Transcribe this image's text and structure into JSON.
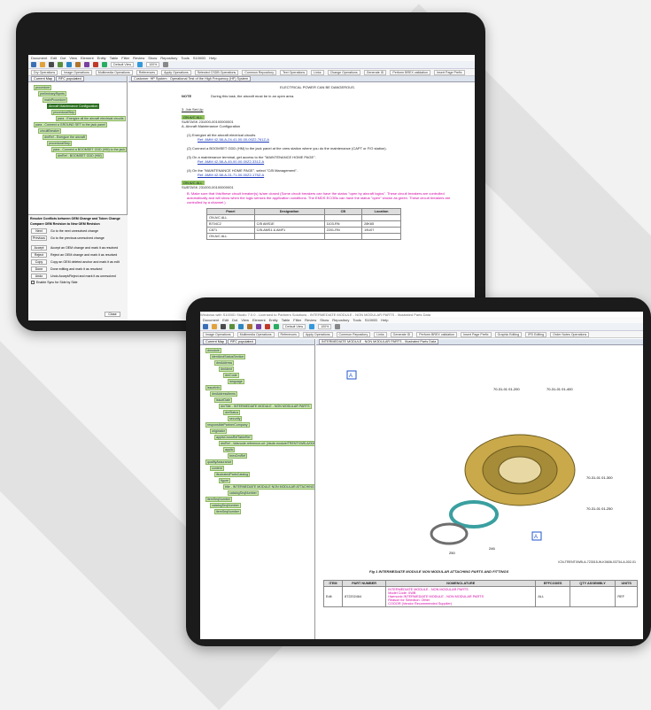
{
  "tablet_a": {
    "menu": [
      "Document",
      "Edit",
      "Dot",
      "View",
      "Element",
      "Entity",
      "Table",
      "Filter",
      "Review",
      "Show",
      "Repository",
      "Tools",
      "S1000D",
      "Help"
    ],
    "ops": [
      "Dry Operations",
      "Image Operations",
      "Multimedia Operations",
      "References",
      "Apply Operations",
      "Selected CSDB Operations",
      "Common Repository",
      "Text Operations",
      "Links",
      "Change Operations",
      "Generate ID",
      "Perform BREX validation",
      "Insert Page Prefix"
    ],
    "zoom": "100%",
    "style_select": "Default View",
    "tabs": [
      "Current Map",
      "RFC populated"
    ],
    "doc_tab": "Customer: HP System · Operational Test of the High Frequency (HF) System",
    "tree": [
      "procedure",
      "preliminaryRqmts",
      "mainProcedure",
      "Aircraft Maintenance Configuration",
      "proceduralStep",
      "para - Energize all the aircraft electrical circuits",
      "para - Connect a GROUND SET to the jack panel",
      "circuitBreaker",
      "dmRef - Energize the aircraft",
      "proceduralStep",
      "para - Connect a BOOMSET GDD (HM) to the jack",
      "dmRef - BOOMSET GDD (HM)"
    ],
    "caution": "ELECTRICAL POWER CAN BE DANGEROUS.",
    "note_label": "NOTE",
    "note_text": "During this task, the aircraft must be in an open area.",
    "section": "3.  Job Set-Up",
    "subtask": "SUBTASK 231000-00100000001",
    "step_a": "A.  Aircraft Maintenance Configuration",
    "steps": [
      {
        "num": "(1)",
        "text": "Energize all the aircraft electrical circuits",
        "ref": "Ref. AMM 42-58-A-24-41-00-00-00Z2-761Z-A"
      },
      {
        "num": "(2)",
        "text": "Connect a BOOMSET GDD (HM) to the jack panel at the crew station where you do the maintenance (CAPT or F/O station).",
        "ref": ""
      },
      {
        "num": "(3)",
        "text": "On a maintenance terminal, get access to the \"MAINTENANCE HOME PAGE\".",
        "ref": "Ref. AMM 42-58-A-45-00-00-00Z2-331Z-A"
      },
      {
        "num": "(4)",
        "text": "On the \"MAINTENANCE HOME PAGE\", select \"C/B Management\".",
        "ref": "Ref. AMM 42-58-A-31-71-00-00Z2-175Z-A"
      }
    ],
    "applic": "ON A/C ALL",
    "subtask2": "SUBTASK 231000-00100000001",
    "step_b": "B.  Make sure that this/these circuit breaker(s) is/are closed (Some circuit breakers can have the status \"open by aircraft logics\". These circuit breakers are controlled automatically and will show when the logic senses the application conditions. The EMDS ECOBs can have the status \"open\" shown as green. These circuit breakers are controlled by a channel.)",
    "cb_table": {
      "headers": [
        "Panel",
        "Designation",
        "CB",
        "Location"
      ],
      "rows": [
        [
          "ON A/C ALL",
          "",
          "",
          ""
        ],
        [
          "B704C2",
          "C/B AMS1E",
          "1103-RN",
          "28K65"
        ],
        [
          "C871",
          "C/B-AMS1 & AMF1",
          "2201-RN",
          "19U07"
        ],
        [
          "ON A/C ALL",
          "",
          "",
          ""
        ]
      ]
    },
    "panel": {
      "title": "Resolve Conflicts between OEM Change and Token Change",
      "subtitle": "Compare OEM Revision to New OEM Revision",
      "nav": [
        {
          "btn": "Next",
          "desc": "Go to the next unresolved change"
        },
        {
          "btn": "Previous",
          "desc": "Go to the previous unresolved change"
        }
      ],
      "actions": [
        {
          "btn": "Accept",
          "desc": "Accept an OEM change and mark it as resolved"
        },
        {
          "btn": "Reject",
          "desc": "Reject an OEM change and mark it as resolved"
        },
        {
          "btn": "Copy",
          "desc": "Copy an OEM deleted anchor and mark it as edit"
        },
        {
          "btn": "Done",
          "desc": "Done editing and mark it as resolved"
        },
        {
          "btn": "Undo",
          "desc": "Undo Accept/Reject and mark it as unresolved"
        }
      ],
      "checkbox": "Enable Sync for Side by Side",
      "close": "Close"
    }
  },
  "tablet_b": {
    "title": "Windows with S1000D Studio 7.0.0 - Licensed to Partners Solutions - INTERMEDIATE MODULE - NON MODULAR PARTS - Illustrated Parts Data",
    "menu": [
      "Document",
      "Edit",
      "Dot",
      "View",
      "Element",
      "Entity",
      "Table",
      "Filter",
      "Review",
      "Show",
      "Repository",
      "Tools",
      "S1000D",
      "Help"
    ],
    "ops": [
      "Image Operations",
      "Multimedia Operations",
      "References",
      "Apply Operations",
      "Common Repository",
      "Links",
      "Generate ID",
      "Perform BREX validation",
      "Insert Page Prefix",
      "Graphic Editing",
      "IPD Editing",
      "Order Notes Operations"
    ],
    "zoom": "100%",
    "style_select": "Default View",
    "tabs": [
      "Current Map",
      "RFC populated"
    ],
    "doc_tab": "INTERMEDIATE MODULE - NON MODULAR PARTS - Illustrated Parts Data",
    "tree": [
      "dmodule",
      "identAndStatusSection",
      "dmAddress",
      "dmIdent",
      "dmCode",
      "language",
      "issueInfo",
      "dmAddressItems",
      "issueDate",
      "dmTitle - INTERMEDIATE MODULE - NON MODULAR PARTS",
      "dmStatus",
      "security",
      "responsiblePartnerCompany",
      "originator",
      "applicCrossRefTableRef",
      "dmRef - /ddsnode-reference-uri: j/dsde-module/TRENTXWB-A/00/00/00",
      "applic",
      "brexDmRef",
      "qualityAssurance",
      "content",
      "illustratedPartsCatalog",
      "figure",
      "title - INTERMEDIATE MODULE NON MODULAR ATTACHING PARTS",
      "catalogSeqNumber",
      "itemSeqNumber",
      "catalogSeqNumber",
      "itemSeqNumber"
    ],
    "figure_id": "ICN-TRENTXWB-A-723015-W-K0606-03734-A-002-01",
    "figure_caption": "Fig 1  INTERMEDIATE MODULE NON MODULAR ATTACHING PARTS AND FITTINGS",
    "callouts": [
      "70-31-01\n01-200",
      "70-31-01\n01-400",
      "70-31-01\n01-300",
      "70-31-01\n01-250",
      "246",
      "250"
    ],
    "ipd_table": {
      "headers": [
        "ITEM",
        "PART NUMBER",
        "NOMENCLATURE",
        "EFFCODES",
        "QTY ASSEMBLY",
        "UNITS"
      ],
      "rows": [
        [
          "Edit",
          "872202464",
          "INTERMEDIATE MODULE - NON MODULAR PARTS",
          "ALL",
          "",
          "REF"
        ]
      ]
    },
    "nomenclature_lines": [
      "Model Code: XWB",
      "Harmonic INTERMEDIATE MODULE - NON MODULAR PARTS",
      "Reason for Selection: Other",
      "COOOR (Vendor Recommended Supplier)"
    ]
  }
}
